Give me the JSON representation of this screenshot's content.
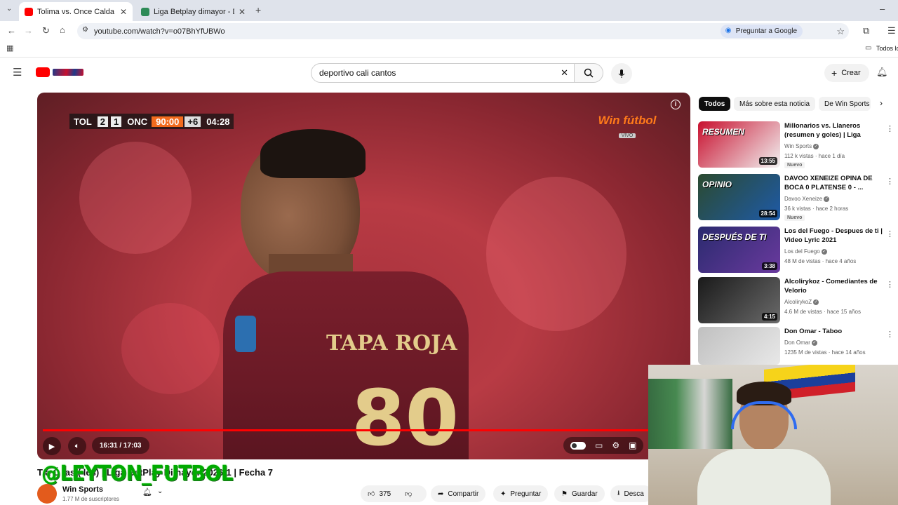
{
  "browser": {
    "tabs": [
      {
        "title": "Tolima vs. Once Caldas (resume",
        "active": true
      },
      {
        "title": "Liga Betplay dimayor - Dimayor",
        "active": false
      }
    ],
    "url": "youtube.com/watch?v=o07BhYfUBWo",
    "ask_google": "Preguntar a Google",
    "bookmarks_right": "Todos lo"
  },
  "header": {
    "search_query": "deportivo cali cantos",
    "create_label": "Crear"
  },
  "player": {
    "scoreboard": {
      "home": "TOL",
      "home_score": "2",
      "away_score": "1",
      "away": "ONC",
      "match_time": "90:00",
      "added": "+6",
      "added_time": "04:28"
    },
    "broadcaster": "Win fútbol",
    "broadcaster_live": "VIVO",
    "jersey_sponsor": "TAPA ROJA",
    "jersey_number": "80",
    "time_display": "16:31 / 17:03",
    "progress": 0.968
  },
  "video": {
    "title": "Tolima vs. Once Caldas (resumen y goles) | Liga BetPlay Dimayor 2026-1 | Fecha 7",
    "title_visible": "T        a        Ó           las (            les) | Liga BetPlay Dimayor 2026-1 | Fecha 7",
    "channel": "Win Sports",
    "subscribers": "1.77 M de suscriptores",
    "likes": "375",
    "share_label": "Compartir",
    "ask_label": "Preguntar",
    "save_label": "Guardar",
    "download_label": "Desca",
    "watermark": "@LEYTON_FUTBOL"
  },
  "sidebar": {
    "chips": [
      "Todos",
      "Más sobre esta noticia",
      "De Win Sports"
    ],
    "recommendations": [
      {
        "title": "Millonarios vs. Llaneros (resumen y goles) | Liga BetPl...",
        "channel": "Win Sports",
        "meta": "112 k vistas · hace 1 día",
        "badge": "Nuevo",
        "duration": "13:55",
        "thumb_text": "RESUMEN",
        "colors": [
          "#c8102e",
          "#f2f2f2"
        ]
      },
      {
        "title": "DAVOO XENEIZE OPINA DE BOCA 0 PLATENSE 0 - ...",
        "channel": "Davoo Xeneize",
        "meta": "36 k vistas · hace 2 horas",
        "badge": "Nuevo",
        "duration": "28:54",
        "thumb_text": "OPINIO",
        "colors": [
          "#2b4a2f",
          "#1e5aa8"
        ]
      },
      {
        "title": "Los del Fuego - Despues de ti | Video Lyric 2021",
        "channel": "Los del Fuego",
        "meta": "48 M de vistas · hace 4 años",
        "badge": "",
        "duration": "3:38",
        "thumb_text": "DESPUÉS DE TI",
        "colors": [
          "#2a2a6e",
          "#6a3a9e"
        ]
      },
      {
        "title": "Alcolirykoz - Comediantes de Velorio",
        "channel": "AlcolirykoZ",
        "meta": "4.6 M de vistas · hace 15 años",
        "badge": "",
        "duration": "4:15",
        "thumb_text": "",
        "colors": [
          "#1a1a1a",
          "#6a6a6a"
        ]
      },
      {
        "title": "Don Omar - Taboo",
        "channel": "Don Omar",
        "meta": "1235 M de vistas · hace 14 años",
        "badge": "",
        "duration": "",
        "thumb_text": "",
        "colors": [
          "#c0c0c0",
          "#e8e8e8"
        ]
      }
    ]
  }
}
